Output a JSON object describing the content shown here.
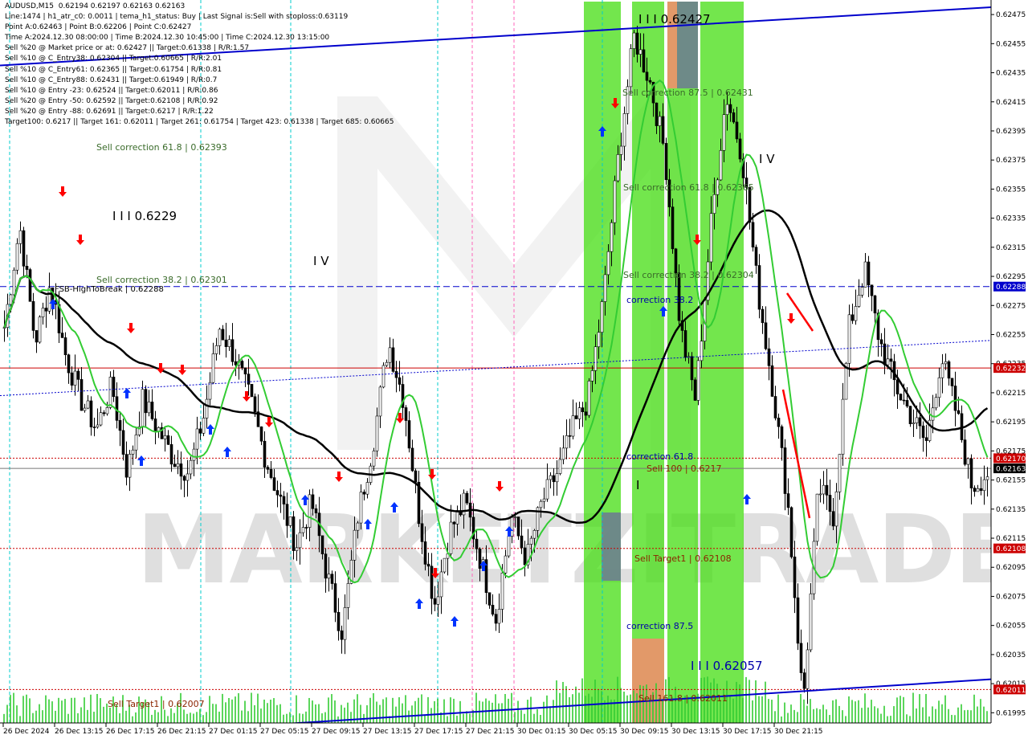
{
  "header": {
    "symbol": "AUDUSD,M15",
    "ohlc": "0.62194 0.62197 0.62163 0.62163"
  },
  "info_lines": [
    "Line:1474 | h1_atr_c0: 0.0011 | tema_h1_status: Buy | Last Signal is:Sell with stoploss:0.63119",
    "Point A:0.62463 | Point B:0.62206 | Point C:0.62427",
    "Time A:2024.12.30 08:00:00 | Time B:2024.12.30 10:45:00 | Time C:2024.12.30 13:15:00",
    "Sell %20 @ Market price or at: 0.62427 || Target:0.61338 | R/R:1.57",
    "Sell %10 @ C_Entry38: 0.62304 || Target:0.60665 | R/R:2.01",
    "Sell %10 @ C_Entry61: 0.62365 || Target:0.61754 | R/R:0.81",
    "Sell %10 @ C_Entry88: 0.62431 || Target:0.61949 | R/R:0.7",
    "Sell %10 @ Entry -23: 0.62524 || Target:0.62011 | R/R:0.86",
    "Sell %20 @ Entry -50: 0.62592 || Target:0.62108 | R/R:0.92",
    "Sell %20 @ Entry -88: 0.62691 || Target:0.6217 | R/R:1.22",
    "Target100: 0.6217 || Target 161: 0.62011 | Target 261: 0.61754 | Target 423: 0.61338 | Target 685: 0.60665"
  ],
  "watermark": "MARKETZITRADE",
  "colors": {
    "background": "#ffffff",
    "candle": "#000000",
    "ma_slow": "#000000",
    "ma_fast": "#33cc33",
    "channel": "#0000cc",
    "green_zone": "#44dd11",
    "orange_zone": "#e8956a",
    "gray_zone": "#6e7f8f",
    "level_red": "#cc0000",
    "level_blue": "#0000cc",
    "buy_arrow": "#0033ff",
    "sell_arrow": "#ff0000",
    "volume": "#33cc33",
    "label_brown": "#8b2500",
    "label_olive": "#3a6b2a",
    "label_blue": "#0000aa"
  },
  "chart_data": {
    "type": "candlestick",
    "symbol": "AUDUSD",
    "timeframe": "M15",
    "ylim": [
      0.61988,
      0.62485
    ],
    "x_ticks": [
      "26 Dec 2024",
      "26 Dec 13:15",
      "26 Dec 17:15",
      "26 Dec 21:15",
      "27 Dec 01:15",
      "27 Dec 05:15",
      "27 Dec 09:15",
      "27 Dec 13:15",
      "27 Dec 17:15",
      "27 Dec 21:15",
      "30 Dec 01:15",
      "30 Dec 05:15",
      "30 Dec 09:15",
      "30 Dec 13:15",
      "30 Dec 17:15",
      "30 Dec 21:15"
    ],
    "y_ticks": [
      0.62475,
      0.62455,
      0.62435,
      0.62415,
      0.62395,
      0.62375,
      0.62355,
      0.62335,
      0.62315,
      0.62295,
      0.62275,
      0.62255,
      0.62235,
      0.62215,
      0.62195,
      0.62175,
      0.62155,
      0.62135,
      0.62115,
      0.62095,
      0.62075,
      0.62055,
      0.62035,
      0.62015,
      0.61995
    ],
    "price_tags": [
      {
        "value": 0.62288,
        "label": "0.62288",
        "color": "#0000cc"
      },
      {
        "value": 0.62232,
        "label": "0.62232",
        "color": "#cc0000"
      },
      {
        "value": 0.6217,
        "label": "0.62170",
        "color": "#cc0000"
      },
      {
        "value": 0.62163,
        "label": "0.62163",
        "color": "#000000"
      },
      {
        "value": 0.62108,
        "label": "0.62108",
        "color": "#cc0000"
      },
      {
        "value": 0.62011,
        "label": "0.62011",
        "color": "#cc0000"
      }
    ],
    "levels": [
      {
        "value": 0.62288,
        "style": "dashed",
        "color": "#0000cc"
      },
      {
        "value": 0.62232,
        "style": "solid",
        "color": "#cc0000"
      },
      {
        "value": 0.6217,
        "style": "dotted",
        "color": "#cc0000"
      },
      {
        "value": 0.62163,
        "style": "solid",
        "color": "#777777"
      },
      {
        "value": 0.62108,
        "style": "dotted",
        "color": "#cc0000"
      },
      {
        "value": 0.62011,
        "style": "dotted",
        "color": "#cc0000"
      }
    ],
    "annotations": [
      {
        "text": "I I I  0.62427",
        "color": "#000000"
      },
      {
        "text": "Sell correction 87.5 | 0.62431",
        "color": "#3a6b2a"
      },
      {
        "text": "Sell correction 61.8 | 0.62393",
        "color": "#3a6b2a"
      },
      {
        "text": "Sell correction 61.8 | 0.62365",
        "color": "#3a6b2a"
      },
      {
        "text": "I V",
        "color": "#000000"
      },
      {
        "text": "I I I  0.6229",
        "color": "#000000"
      },
      {
        "text": "I V",
        "color": "#000000"
      },
      {
        "text": "Sell correction 38.2 | 0.62301",
        "color": "#3a6b2a"
      },
      {
        "text": "FSB-HighToBreak | 0.62288",
        "color": "#000000"
      },
      {
        "text": "Sell correction 38.2 | 0.62304",
        "color": "#3a6b2a"
      },
      {
        "text": "correction 38.2",
        "color": "#0000aa"
      },
      {
        "text": "correction 61.8",
        "color": "#0000aa"
      },
      {
        "text": "Sell 100 | 0.6217",
        "color": "#8b2500"
      },
      {
        "text": "I",
        "color": "#000000"
      },
      {
        "text": "Sell Target1 | 0.62108",
        "color": "#8b2500"
      },
      {
        "text": "correction 87.5",
        "color": "#0000aa"
      },
      {
        "text": "I I I  0.62057",
        "color": "#0000aa"
      },
      {
        "text": "Sell Target1 | 0.62007",
        "color": "#8b2500"
      },
      {
        "text": "Sell 161.8 | 0.62011",
        "color": "#8b2500"
      }
    ],
    "price_path": [
      [
        0.6226,
        0.6233,
        0.6225,
        0.6229,
        0.6224,
        0.6221
      ],
      [
        0.6219,
        0.6222,
        0.6216,
        0.6221,
        0.6219,
        0.6217
      ],
      [
        0.6216,
        0.622,
        0.6226,
        0.6224,
        0.6221,
        0.6217
      ],
      [
        0.6214,
        0.6211,
        0.6214,
        0.6209,
        0.6205,
        0.6213
      ],
      [
        0.6218,
        0.6225,
        0.6221,
        0.6213,
        0.6207,
        0.6212
      ],
      [
        0.6214,
        0.621,
        0.6206,
        0.6213,
        0.621,
        0.6214
      ],
      [
        0.6216,
        0.6219,
        0.6221,
        0.6228,
        0.6238,
        0.6246
      ],
      [
        0.6243,
        0.6238,
        0.6226,
        0.6221,
        0.6233,
        0.6242
      ],
      [
        0.6238,
        0.6229,
        0.6222,
        0.6214,
        0.62,
        0.6215
      ],
      [
        0.6213,
        0.6226,
        0.623,
        0.6225,
        0.6222,
        0.622
      ],
      [
        0.6218,
        0.6224,
        0.622,
        0.6215,
        0.6216
      ]
    ]
  }
}
